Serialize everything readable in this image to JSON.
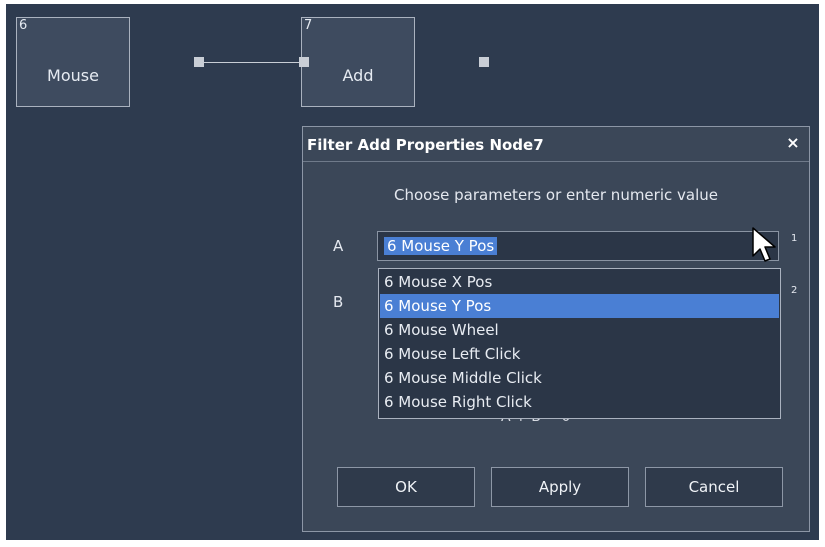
{
  "nodes": [
    {
      "id": "6",
      "label": "Mouse"
    },
    {
      "id": "7",
      "label": "Add"
    }
  ],
  "dialog": {
    "title": "Filter Add Properties Node7",
    "close_label": "×",
    "instruction": "Choose parameters or enter numeric value",
    "param_a_label": "A",
    "param_b_label": "B",
    "param_a_index": "1",
    "param_b_index": "2",
    "param_a_value": "6 Mouse Y Pos",
    "dropdown_options": [
      "6 Mouse X Pos",
      "6 Mouse Y Pos",
      "6 Mouse Wheel",
      "6 Mouse Left Click",
      "6 Mouse Middle Click",
      "6 Mouse Right Click"
    ],
    "dropdown_selected": "6 Mouse Y Pos",
    "formula_partial": "A + B = 0",
    "buttons": {
      "ok": "OK",
      "apply": "Apply",
      "cancel": "Cancel"
    }
  },
  "icons": [
    "dropdown-arrow-icon",
    "close-icon",
    "mouse-pointer-icon"
  ]
}
